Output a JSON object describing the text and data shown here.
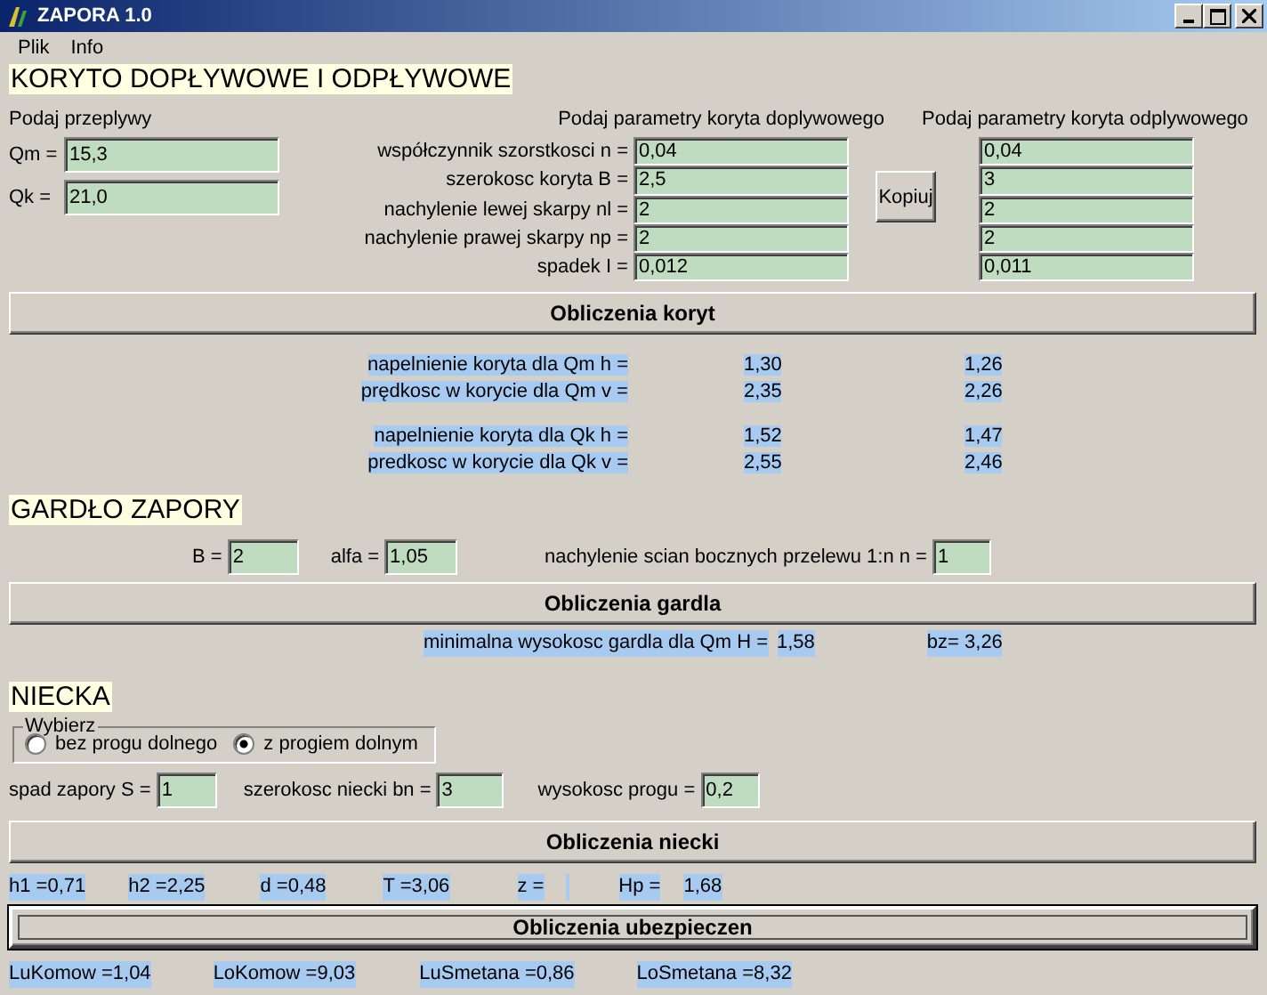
{
  "window": {
    "title": "ZAPORA 1.0"
  },
  "menu": [
    "Plik",
    "Info"
  ],
  "channel": {
    "heading": "KORYTO DOPŁYWOWE I ODPŁYWOWE",
    "flows_label": "Podaj przeplywy",
    "inlet_header": "Podaj parametry koryta doplywowego",
    "outlet_header": "Podaj parametry koryta odplywowego",
    "flows": [
      {
        "label": "Qm =",
        "value": "15,3"
      },
      {
        "label": "Qk =",
        "value": "21,0"
      }
    ],
    "params": [
      {
        "label": "współczynnik szorstkosci n =",
        "inlet": "0,04",
        "outlet": "0,04"
      },
      {
        "label": "szerokosc koryta B =",
        "inlet": "2,5",
        "outlet": "3"
      },
      {
        "label": "nachylenie lewej skarpy nl =",
        "inlet": "2",
        "outlet": "2"
      },
      {
        "label": "nachylenie prawej skarpy np =",
        "inlet": "2",
        "outlet": "2"
      },
      {
        "label": "spadek I =",
        "inlet": "0,012",
        "outlet": "0,011"
      }
    ],
    "copy_button": "Kopiuj",
    "calc_button": {
      "label": "Obliczenia koryt",
      "focused": false
    },
    "results": [
      [
        {
          "label": "napelnienie koryta dla Qm h =",
          "inlet": "1,30",
          "outlet": "1,26"
        },
        {
          "label": "prędkosc w korycie dla Qm v =",
          "inlet": "2,35",
          "outlet": "2,26"
        }
      ],
      [
        {
          "label": "napelnienie koryta dla Qk h =",
          "inlet": "1,52",
          "outlet": "1,47"
        },
        {
          "label": "predkosc w korycie dla Qk v =",
          "inlet": "2,55",
          "outlet": "2,46"
        }
      ]
    ]
  },
  "throat": {
    "heading": "GARDŁO ZAPORY",
    "inputs": [
      {
        "label": "B =",
        "value": "2"
      },
      {
        "label": "alfa =",
        "value": "1,05"
      },
      {
        "label": "nachylenie scian bocznych przelewu 1:n n =",
        "value": "1"
      }
    ],
    "calc_button": {
      "label": "Obliczenia gardla",
      "focused": false
    },
    "result": {
      "label": "minimalna wysokosc gardla dla Qm H =",
      "value": "1,58",
      "bz": "bz= 3,26"
    }
  },
  "basin": {
    "heading": "NIECKA",
    "choice": {
      "label": "Wybierz",
      "options": [
        {
          "label": "bez progu dolnego",
          "selected": false
        },
        {
          "label": "z progiem dolnym",
          "selected": true
        }
      ]
    },
    "inputs": [
      {
        "label": "spad zapory S =",
        "value": "1"
      },
      {
        "label": "szerokosc niecki bn =",
        "value": "3"
      },
      {
        "label": "wysokosc progu =",
        "value": "0,2"
      }
    ],
    "calc_button": {
      "label": "Obliczenia niecki",
      "focused": false
    },
    "results": [
      {
        "kind": "text",
        "text": "h1 =0,71"
      },
      {
        "kind": "text",
        "text": "h2 =2,25"
      },
      {
        "kind": "text",
        "text": "d =0,48"
      },
      {
        "kind": "text",
        "text": "T =3,06"
      },
      {
        "kind": "text",
        "text": "z ="
      },
      {
        "kind": "blank"
      },
      {
        "kind": "text",
        "text": "Hp ="
      },
      {
        "kind": "text",
        "text": "1,68"
      }
    ],
    "protection_button": {
      "label": "Obliczenia ubezpieczen",
      "focused": true
    },
    "protection_results": [
      "LuKomow =1,04",
      "LoKomow =9,03",
      "LuSmetana =0,86",
      "LoSmetana =8,32"
    ]
  }
}
